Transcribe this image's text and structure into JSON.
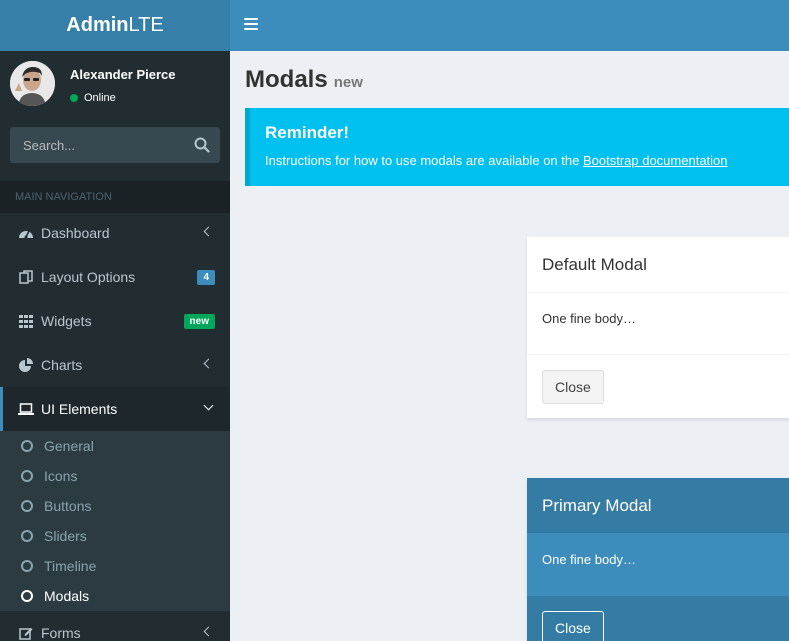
{
  "header": {
    "logo_bold": "Admin",
    "logo_rest": "LTE"
  },
  "user": {
    "name": "Alexander Pierce",
    "status": "Online"
  },
  "search": {
    "placeholder": "Search..."
  },
  "nav": {
    "header": "MAIN NAVIGATION",
    "items": [
      {
        "label": "Dashboard",
        "icon": "dashboard-icon"
      },
      {
        "label": "Layout Options",
        "icon": "files-icon",
        "badge": "4"
      },
      {
        "label": "Widgets",
        "icon": "grid-icon",
        "badge": "new"
      },
      {
        "label": "Charts",
        "icon": "pie-chart-icon"
      },
      {
        "label": "UI Elements",
        "icon": "laptop-icon"
      },
      {
        "label": "Forms",
        "icon": "edit-icon"
      }
    ],
    "ui_elements": [
      "General",
      "Icons",
      "Buttons",
      "Sliders",
      "Timeline",
      "Modals"
    ]
  },
  "page": {
    "title": "Modals",
    "subtitle": "new"
  },
  "callout": {
    "title": "Reminder!",
    "text": "Instructions for how to use modals are available on the ",
    "link": "Bootstrap documentation"
  },
  "modals": {
    "default": {
      "title": "Default Modal",
      "body": "One fine body…",
      "close": "Close"
    },
    "primary": {
      "title": "Primary Modal",
      "body": "One fine body…",
      "close": "Close"
    }
  },
  "colors": {
    "brand": "#3c8dbc",
    "sidebar": "#222d32",
    "callout_info": "#00c0ef",
    "badge_blue": "#3c8dbc",
    "badge_green": "#00a65a"
  }
}
